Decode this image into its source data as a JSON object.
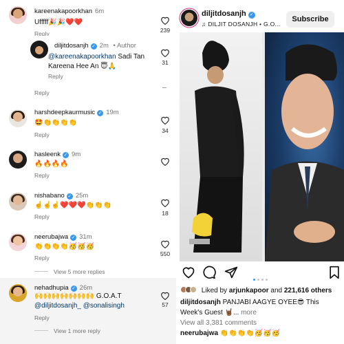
{
  "comments": [
    {
      "user": "kareenakapoorkhan",
      "time": "6m",
      "text": "Ufffff🎉🎉❤️❤️",
      "reply": "Reply",
      "likes": "239"
    },
    {
      "user": "diljitdosanjh",
      "time": "2m",
      "author_tag": "• Author",
      "mention": "@kareenakapoorkhan",
      "text": "Sadi Tan Kareena Hee An 😇🙏",
      "reply": "Reply",
      "likes": "31"
    },
    {
      "reply": "Reply"
    },
    {
      "user": "harshdeepkaurmusic",
      "time": "19m",
      "text": "🤩👏👏👏👏",
      "reply": "Reply",
      "likes": "34"
    },
    {
      "user": "hasleenk",
      "time": "9m",
      "text": "🔥🔥🔥🔥",
      "reply": "Reply",
      "likes": ""
    },
    {
      "user": "nishabano",
      "time": "25m",
      "text": "☝️☝️☝️❤️❤️❤️👏👏👏",
      "reply": "Reply",
      "likes": "18"
    },
    {
      "user": "neerubajwa",
      "time": "31m",
      "text": "👏👏👏👏🥳🥳🥳",
      "reply": "Reply",
      "likes": "550"
    },
    {
      "user": "nehadhupia",
      "time": "26m",
      "text": "🙌🙌🙌🙌🙌🙌🙌 G.O.A.T",
      "mentions": "@diljitdosanjh_ @sonalisingh",
      "reply": "Reply",
      "likes": "57"
    }
  ],
  "view_more_1": "View 5 more replies",
  "view_more_2": "View 1 more reply",
  "post": {
    "user": "diljitdosanjh",
    "music": "♫ DILJIT DOSANJH • G.O...",
    "subscribe": "Subscribe",
    "liked_prefix": "Liked by",
    "liked_user": "arjunkapoor",
    "liked_and": "and",
    "liked_count": "221,616 others",
    "caption_user": "diljitdosanjh",
    "caption_text": "PANJABI AAGYE OYEE😎 This Week's Guest 🤘🏾...",
    "caption_more": "more",
    "view_all": "View all 3,381 comments",
    "preview_user": "neerubajwa",
    "preview_text": "👏👏👏👏🥳🥳🥳",
    "carousel_index": 1,
    "carousel_total": 4
  },
  "colors": {
    "verified": "#3897f0",
    "link": "#00376b",
    "muted": "#737373",
    "subscribe_bg": "#efefef"
  }
}
